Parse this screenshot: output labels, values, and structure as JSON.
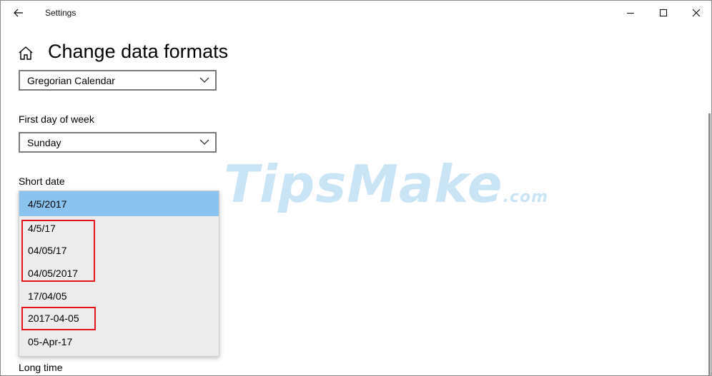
{
  "window": {
    "title": "Settings",
    "controls": {
      "back": "back-arrow-icon",
      "minimize": "minimize-icon",
      "maximize": "maximize-icon",
      "close": "close-icon"
    }
  },
  "header": {
    "title": "Change data formats",
    "home_icon": "home-icon"
  },
  "calendar": {
    "value": "Gregorian Calendar"
  },
  "first_day_of_week": {
    "label": "First day of week",
    "value": "Sunday"
  },
  "short_date": {
    "label": "Short date",
    "options": [
      "4/5/2017",
      "4/5/17",
      "04/05/17",
      "04/05/2017",
      "17/04/05",
      "2017-04-05",
      "05-Apr-17"
    ],
    "selected": "4/5/2017"
  },
  "long_time": {
    "label": "Long time"
  },
  "watermark": {
    "main": "TipsMake",
    "suffix": ".com"
  },
  "colors": {
    "accent": "#8bc3ef",
    "highlight_box": "#e3141b",
    "watermark": "#b7dcf2"
  }
}
